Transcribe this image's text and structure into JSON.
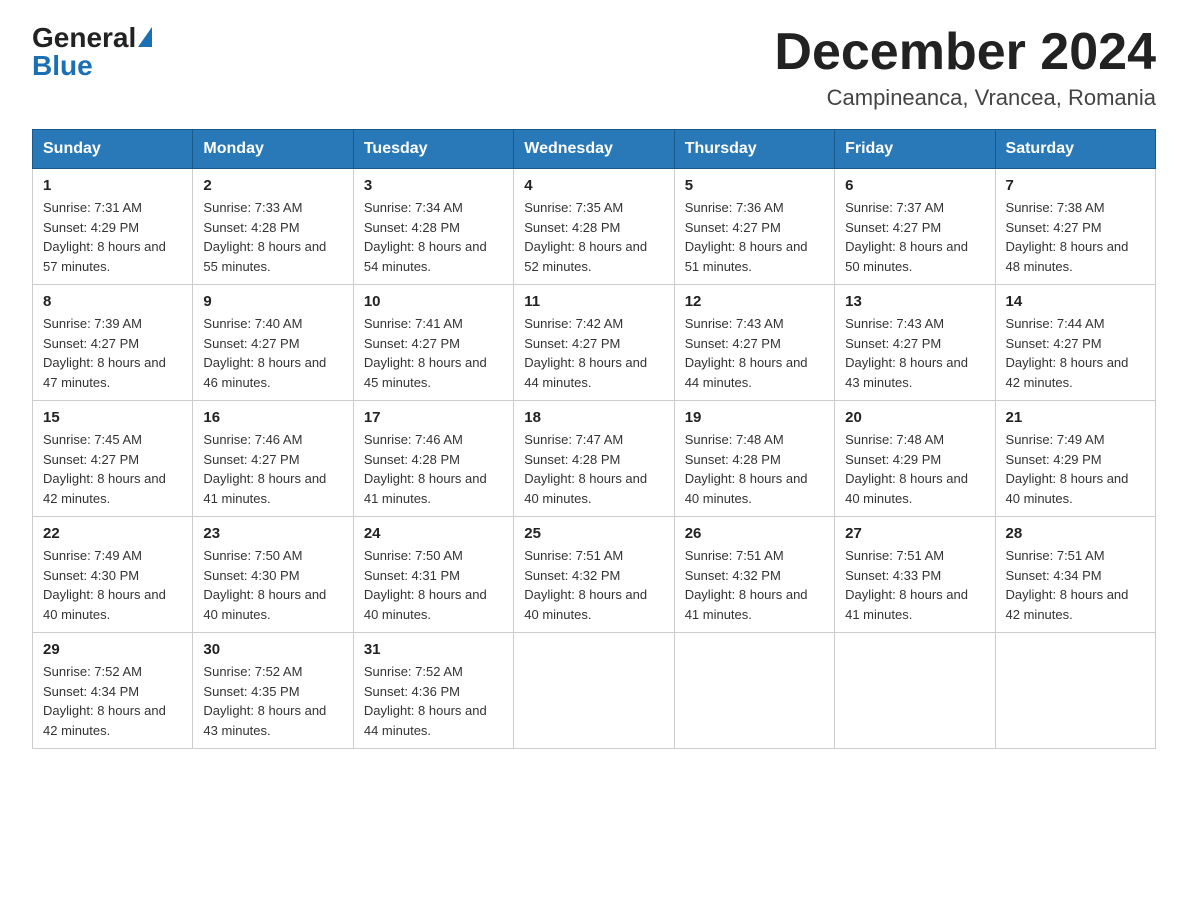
{
  "logo": {
    "general": "General",
    "blue": "Blue"
  },
  "header": {
    "month_year": "December 2024",
    "location": "Campineanca, Vrancea, Romania"
  },
  "weekdays": [
    "Sunday",
    "Monday",
    "Tuesday",
    "Wednesday",
    "Thursday",
    "Friday",
    "Saturday"
  ],
  "weeks": [
    [
      {
        "day": "1",
        "sunrise": "7:31 AM",
        "sunset": "4:29 PM",
        "daylight": "8 hours and 57 minutes."
      },
      {
        "day": "2",
        "sunrise": "7:33 AM",
        "sunset": "4:28 PM",
        "daylight": "8 hours and 55 minutes."
      },
      {
        "day": "3",
        "sunrise": "7:34 AM",
        "sunset": "4:28 PM",
        "daylight": "8 hours and 54 minutes."
      },
      {
        "day": "4",
        "sunrise": "7:35 AM",
        "sunset": "4:28 PM",
        "daylight": "8 hours and 52 minutes."
      },
      {
        "day": "5",
        "sunrise": "7:36 AM",
        "sunset": "4:27 PM",
        "daylight": "8 hours and 51 minutes."
      },
      {
        "day": "6",
        "sunrise": "7:37 AM",
        "sunset": "4:27 PM",
        "daylight": "8 hours and 50 minutes."
      },
      {
        "day": "7",
        "sunrise": "7:38 AM",
        "sunset": "4:27 PM",
        "daylight": "8 hours and 48 minutes."
      }
    ],
    [
      {
        "day": "8",
        "sunrise": "7:39 AM",
        "sunset": "4:27 PM",
        "daylight": "8 hours and 47 minutes."
      },
      {
        "day": "9",
        "sunrise": "7:40 AM",
        "sunset": "4:27 PM",
        "daylight": "8 hours and 46 minutes."
      },
      {
        "day": "10",
        "sunrise": "7:41 AM",
        "sunset": "4:27 PM",
        "daylight": "8 hours and 45 minutes."
      },
      {
        "day": "11",
        "sunrise": "7:42 AM",
        "sunset": "4:27 PM",
        "daylight": "8 hours and 44 minutes."
      },
      {
        "day": "12",
        "sunrise": "7:43 AM",
        "sunset": "4:27 PM",
        "daylight": "8 hours and 44 minutes."
      },
      {
        "day": "13",
        "sunrise": "7:43 AM",
        "sunset": "4:27 PM",
        "daylight": "8 hours and 43 minutes."
      },
      {
        "day": "14",
        "sunrise": "7:44 AM",
        "sunset": "4:27 PM",
        "daylight": "8 hours and 42 minutes."
      }
    ],
    [
      {
        "day": "15",
        "sunrise": "7:45 AM",
        "sunset": "4:27 PM",
        "daylight": "8 hours and 42 minutes."
      },
      {
        "day": "16",
        "sunrise": "7:46 AM",
        "sunset": "4:27 PM",
        "daylight": "8 hours and 41 minutes."
      },
      {
        "day": "17",
        "sunrise": "7:46 AM",
        "sunset": "4:28 PM",
        "daylight": "8 hours and 41 minutes."
      },
      {
        "day": "18",
        "sunrise": "7:47 AM",
        "sunset": "4:28 PM",
        "daylight": "8 hours and 40 minutes."
      },
      {
        "day": "19",
        "sunrise": "7:48 AM",
        "sunset": "4:28 PM",
        "daylight": "8 hours and 40 minutes."
      },
      {
        "day": "20",
        "sunrise": "7:48 AM",
        "sunset": "4:29 PM",
        "daylight": "8 hours and 40 minutes."
      },
      {
        "day": "21",
        "sunrise": "7:49 AM",
        "sunset": "4:29 PM",
        "daylight": "8 hours and 40 minutes."
      }
    ],
    [
      {
        "day": "22",
        "sunrise": "7:49 AM",
        "sunset": "4:30 PM",
        "daylight": "8 hours and 40 minutes."
      },
      {
        "day": "23",
        "sunrise": "7:50 AM",
        "sunset": "4:30 PM",
        "daylight": "8 hours and 40 minutes."
      },
      {
        "day": "24",
        "sunrise": "7:50 AM",
        "sunset": "4:31 PM",
        "daylight": "8 hours and 40 minutes."
      },
      {
        "day": "25",
        "sunrise": "7:51 AM",
        "sunset": "4:32 PM",
        "daylight": "8 hours and 40 minutes."
      },
      {
        "day": "26",
        "sunrise": "7:51 AM",
        "sunset": "4:32 PM",
        "daylight": "8 hours and 41 minutes."
      },
      {
        "day": "27",
        "sunrise": "7:51 AM",
        "sunset": "4:33 PM",
        "daylight": "8 hours and 41 minutes."
      },
      {
        "day": "28",
        "sunrise": "7:51 AM",
        "sunset": "4:34 PM",
        "daylight": "8 hours and 42 minutes."
      }
    ],
    [
      {
        "day": "29",
        "sunrise": "7:52 AM",
        "sunset": "4:34 PM",
        "daylight": "8 hours and 42 minutes."
      },
      {
        "day": "30",
        "sunrise": "7:52 AM",
        "sunset": "4:35 PM",
        "daylight": "8 hours and 43 minutes."
      },
      {
        "day": "31",
        "sunrise": "7:52 AM",
        "sunset": "4:36 PM",
        "daylight": "8 hours and 44 minutes."
      },
      null,
      null,
      null,
      null
    ]
  ]
}
